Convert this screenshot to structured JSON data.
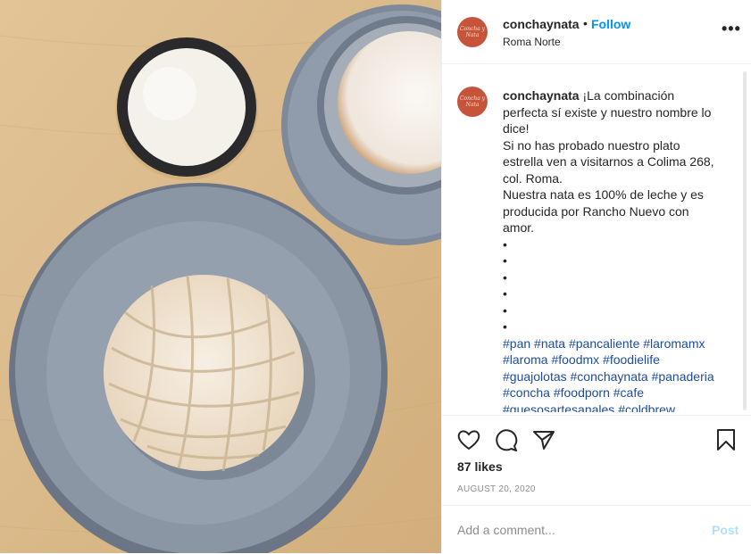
{
  "post": {
    "username": "conchaynata",
    "follow_label": "Follow",
    "dot": "•",
    "location": "Roma Norte",
    "more_label": "•••",
    "avatar_text": "Concha y Nata",
    "caption_lines": [
      {
        "text": "¡La combinación",
        "prefix_user": true
      },
      {
        "text": "perfecta sí existe y nuestro nombre lo"
      },
      {
        "text": "dice!"
      },
      {
        "text": "Si no has probado nuestro plato"
      },
      {
        "text": "estrella ven a visitarnos a Colima 268,"
      },
      {
        "text": "col. Roma."
      },
      {
        "text": "Nuestra nata es 100% de leche y es"
      },
      {
        "text": "producida por Rancho Nuevo con"
      },
      {
        "text": "amor."
      },
      {
        "text": "•"
      },
      {
        "text": "•"
      },
      {
        "text": "•"
      },
      {
        "text": "•"
      },
      {
        "text": "•"
      },
      {
        "text": "•"
      }
    ],
    "hashtag_lines": [
      "#pan #nata #pancaliente #laromamx",
      "#laroma #foodmx #foodielife",
      "#guajolotas #conchaynata #panaderia",
      "#concha #foodporn #cafe",
      "#quesosartesanales #coldbrew"
    ],
    "likes": "87 likes",
    "date": "AUGUST 20, 2020",
    "comment_placeholder": "Add a comment...",
    "post_label": "Post"
  },
  "icons": {
    "like": "heart-icon",
    "comment": "comment-bubble-icon",
    "share": "paper-plane-icon",
    "save": "bookmark-icon"
  },
  "colors": {
    "avatar": "#c5543a",
    "follow": "#0095f6",
    "hashtag": "#1c4c9b",
    "post_disabled": "#b2dffc"
  }
}
